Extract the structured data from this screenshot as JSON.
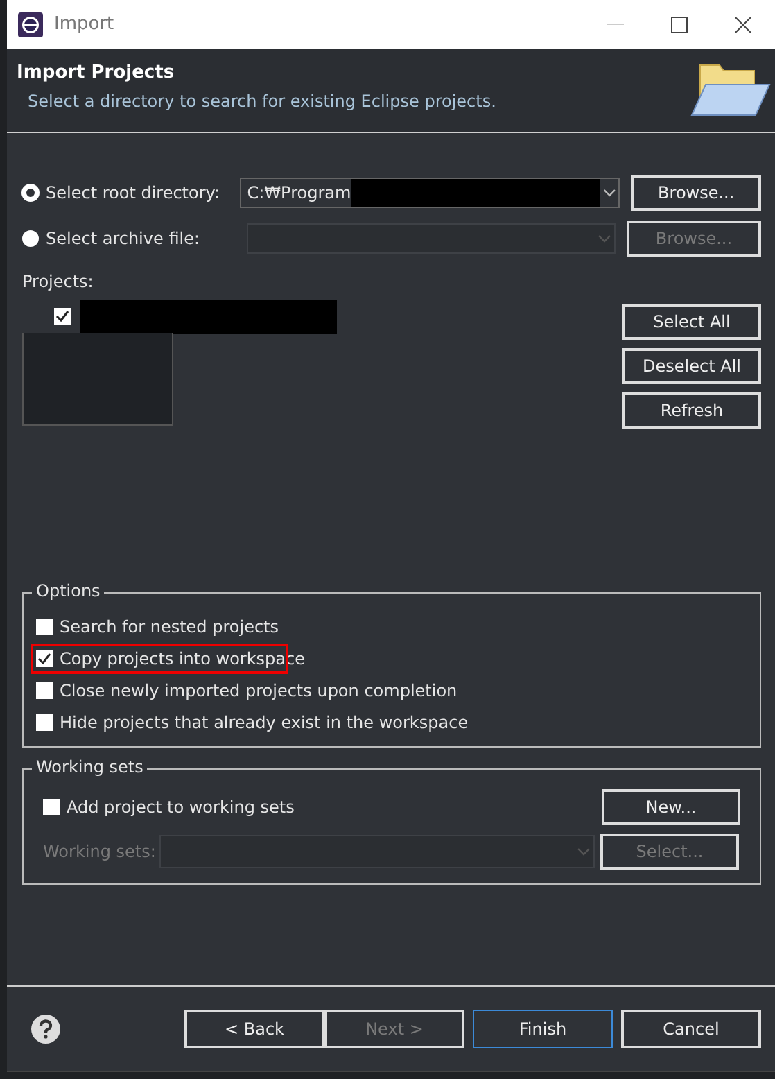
{
  "window": {
    "title": "Import"
  },
  "header": {
    "title": "Import Projects",
    "description": "Select a directory to search for existing Eclipse projects."
  },
  "sources": [
    {
      "label": "Select root directory:",
      "selected": true,
      "value": "C:₩Program",
      "redacted": true,
      "disabled": false,
      "button": "Browse..."
    },
    {
      "label": "Select archive file:",
      "selected": false,
      "redacted": false,
      "disabled": true,
      "button": "Browse..."
    }
  ],
  "projects": {
    "label": "Projects:",
    "items": [
      {
        "checked": true,
        "redacted": true
      }
    ],
    "buttons": [
      "Select All",
      "Deselect All",
      "Refresh"
    ]
  },
  "options": {
    "title": "Options",
    "items": [
      {
        "label": "Search for nested projects",
        "checked": false,
        "highlighted": false
      },
      {
        "label": "Copy projects into workspace",
        "checked": true,
        "highlighted": true
      },
      {
        "label": "Close newly imported projects upon completion",
        "checked": false,
        "highlighted": false
      },
      {
        "label": "Hide projects that already exist in the workspace",
        "checked": false,
        "highlighted": false
      }
    ]
  },
  "working_sets": {
    "title": "Working sets",
    "checkbox": {
      "label": "Add project to working sets",
      "checked": false
    },
    "new_button": {
      "label": "New...",
      "disabled": false
    },
    "field_label": "Working sets:",
    "field_disabled": true,
    "select_button": {
      "label": "Select...",
      "disabled": true
    }
  },
  "footer": {
    "buttons": [
      {
        "label": "< Back",
        "disabled": false,
        "default": false
      },
      {
        "label": "Next >",
        "disabled": true,
        "default": false
      },
      {
        "label": "Finish",
        "disabled": false,
        "default": true
      },
      {
        "label": "Cancel",
        "disabled": false,
        "default": false
      }
    ]
  }
}
